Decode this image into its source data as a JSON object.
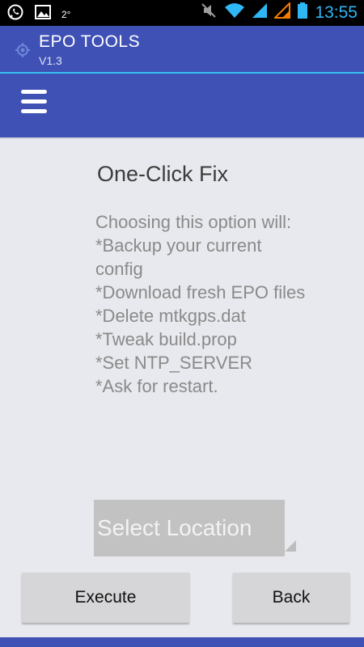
{
  "status_bar": {
    "time": "13:55",
    "temperature": "2°",
    "left_icons": [
      "whatsapp-icon",
      "gallery-icon"
    ],
    "right_icons": [
      "mute-icon",
      "wifi-icon",
      "signal-icon",
      "signal-orange-icon",
      "battery-icon"
    ],
    "time_color": "#2fb6f5"
  },
  "action_bar": {
    "title": "EPO TOOLS",
    "subtitle": "V1.3",
    "icon": "gps-target-icon",
    "color": "#3f51b5",
    "divider_color": "#38c0f0"
  },
  "toolbar": {
    "menu_icon": "hamburger-menu-icon"
  },
  "main": {
    "heading": "One-Click Fix",
    "description_lines": [
      "Choosing this option will:",
      "*Backup your current",
      "config",
      "*Download fresh EPO files",
      "*Delete mtkgps.dat",
      "*Tweak build.prop",
      "*Set NTP_SERVER",
      "*Ask for restart."
    ],
    "select_location_label": "Select Location"
  },
  "buttons": {
    "execute_label": "Execute",
    "back_label": "Back"
  }
}
